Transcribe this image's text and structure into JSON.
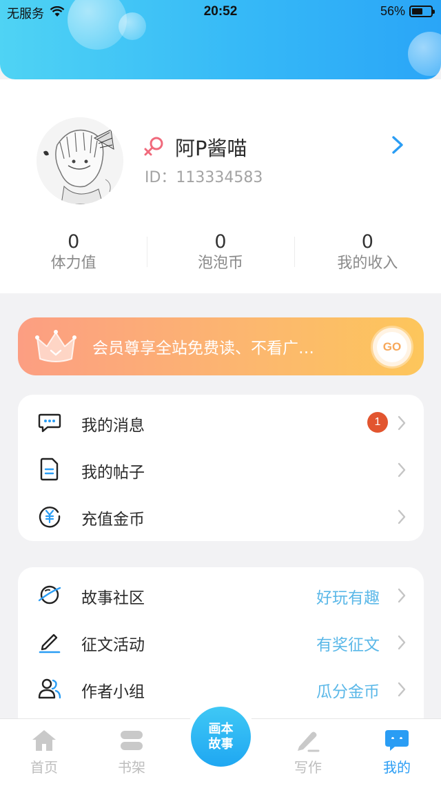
{
  "status_bar": {
    "carrier": "无服务",
    "time": "20:52",
    "battery": "56%",
    "battery_level": 0.56
  },
  "profile": {
    "username": "阿P酱喵",
    "id": "ID：113334583",
    "stats": [
      {
        "value": "0",
        "label": "体力值"
      },
      {
        "value": "0",
        "label": "泡泡币"
      },
      {
        "value": "0",
        "label": "我的收入"
      }
    ]
  },
  "vip_banner": {
    "text": "会员尊享全站免费读、不看广…",
    "go_label": "GO"
  },
  "menu_group_1": [
    {
      "label": "我的消息",
      "badge": "1",
      "icon": "message-icon"
    },
    {
      "label": "我的帖子",
      "icon": "document-icon"
    },
    {
      "label": "充值金币",
      "icon": "coin-icon"
    }
  ],
  "menu_group_2": [
    {
      "label": "故事社区",
      "extra": "好玩有趣",
      "icon": "planet-icon"
    },
    {
      "label": "征文活动",
      "extra": "有奖征文",
      "icon": "pencil-icon"
    },
    {
      "label": "作者小组",
      "extra": "瓜分金币",
      "icon": "group-icon"
    }
  ],
  "tab_bar": {
    "tabs": [
      {
        "label": "首页",
        "icon": "home-icon"
      },
      {
        "label": "书架",
        "icon": "bookshelf-icon"
      },
      {
        "label": "写作",
        "icon": "write-icon"
      },
      {
        "label": "我的",
        "icon": "profile-chat-icon",
        "active": true
      }
    ],
    "center": {
      "line1": "画本",
      "line2": "故事"
    }
  },
  "colors": {
    "accent": "#2a9df4",
    "header_start": "#4fd3f4",
    "header_end": "#2aa5f7",
    "badge": "#e2552f",
    "extra_text": "#5bb8e8"
  }
}
